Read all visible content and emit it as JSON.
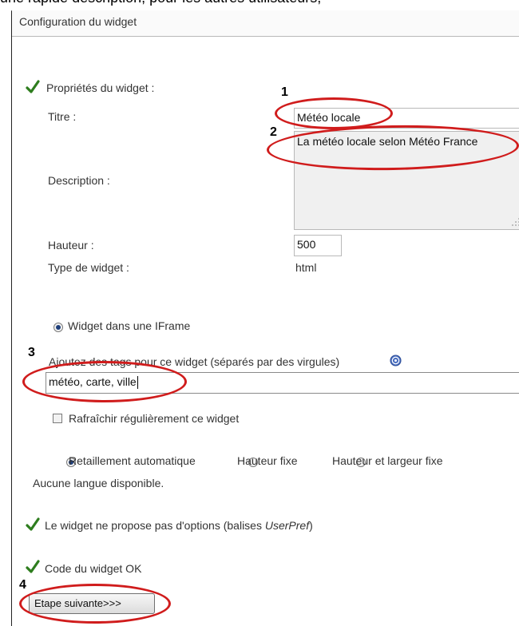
{
  "caption_cut": "une rapide description, pour les autres utilisateurs,",
  "header": {
    "title": "Configuration du widget"
  },
  "props": {
    "heading": "Propriétés du widget :",
    "title_label": "Titre :",
    "title_value": "Météo locale",
    "description_label": "Description :",
    "description_value": "La météo locale selon Météo France",
    "height_label": "Hauteur :",
    "height_value": "500",
    "type_label": "Type de widget :",
    "type_value": "html"
  },
  "iframe_option": "Widget dans une IFrame",
  "tags": {
    "label": "Ajoutez des tags pour ce widget (séparés par des virgules)",
    "value": "météo, carte, ville"
  },
  "refresh_label": "Rafraîchir régulièrement ce widget",
  "sizing": {
    "auto": "Retaillement automatique",
    "fixed_height": "Hauteur fixe",
    "fixed_both": "Hauteur et largeur fixe"
  },
  "no_language": "Aucune langue disponible.",
  "options_status": {
    "prefix": "Le widget ne propose pas d'options (balises ",
    "em": "UserPref",
    "suffix": ")"
  },
  "code_status": "Code du widget OK",
  "next_button": "Etape suivante>>>",
  "annotations": [
    "1",
    "2",
    "3",
    "4"
  ],
  "colors": {
    "check": "#2e7d1e",
    "highlight": "#d01c1c",
    "radio_on": "#1f3f7a"
  }
}
